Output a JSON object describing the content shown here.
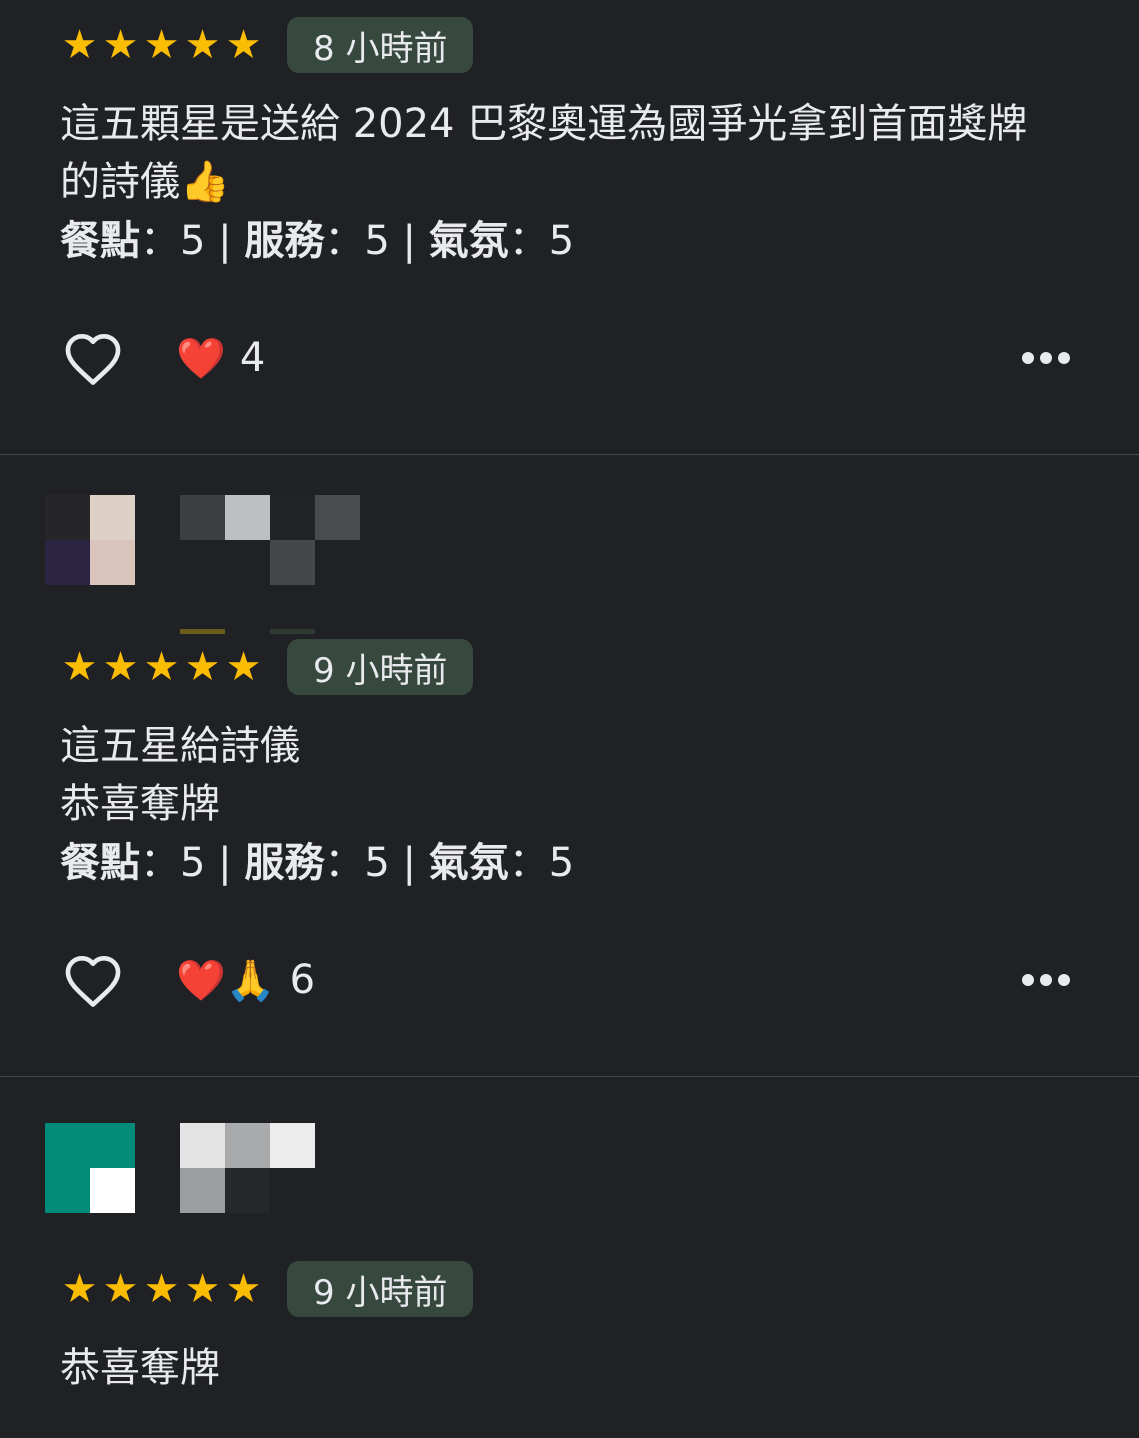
{
  "reviews": [
    {
      "stars": [
        "★",
        "★",
        "★",
        "★",
        "★"
      ],
      "time": "8 小時前",
      "text_lines": [
        "這五顆星是送給 2024 巴黎奧運為國爭光拿到首面獎牌",
        "的詩儀👍"
      ],
      "ratings": {
        "food_label": "餐點",
        "food_value": "：5 |",
        "service_label": "服務",
        "service_value": "：5 |",
        "atmosphere_label": "氣氛",
        "atmosphere_value": "：5"
      },
      "reactions": {
        "emojis": "❤️",
        "count": "4"
      }
    },
    {
      "stars": [
        "★",
        "★",
        "★",
        "★",
        "★"
      ],
      "time": "9 小時前",
      "text_lines": [
        "這五星給詩儀",
        "恭喜奪牌"
      ],
      "ratings": {
        "food_label": "餐點",
        "food_value": "：5 |",
        "service_label": "服務",
        "service_value": "：5 |",
        "atmosphere_label": "氣氛",
        "atmosphere_value": "：5"
      },
      "reactions": {
        "emojis": "❤️🙏",
        "count": "6"
      }
    },
    {
      "stars": [
        "★",
        "★",
        "★",
        "★",
        "★"
      ],
      "time": "9 小時前",
      "text_lines": [
        "恭喜奪牌"
      ]
    }
  ],
  "icons": {
    "like": "heart-outline-icon",
    "more": "more-horizontal-icon"
  },
  "colors": {
    "background": "#202124",
    "star": "#fbbc04",
    "time_chip": "#37483f",
    "text": "#e8eaed",
    "divider": "#45474b"
  }
}
